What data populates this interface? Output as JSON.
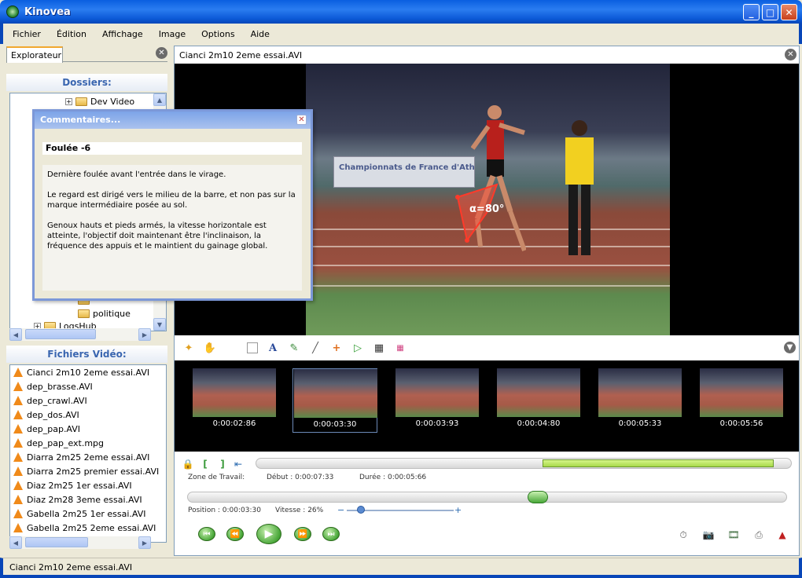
{
  "window": {
    "title": "Kinovea"
  },
  "menu": [
    "Fichier",
    "Édition",
    "Affichage",
    "Image",
    "Options",
    "Aide"
  ],
  "explorer": {
    "tab_label": "Explorateur",
    "folders_heading": "Dossiers:",
    "tree": [
      {
        "label": "Dev Video",
        "expander": "+"
      },
      {
        "label": "",
        "expander": ""
      },
      {
        "label": "politique",
        "expander": ""
      },
      {
        "label": "LogsHub",
        "expander": "+"
      }
    ],
    "videos_heading": "Fichiers Vidéo:",
    "videos": [
      "Cianci 2m10 2eme essai.AVI",
      "dep_brasse.AVI",
      "dep_crawl.AVI",
      "dep_dos.AVI",
      "dep_pap.AVI",
      "dep_pap_ext.mpg",
      "Diarra 2m25 2eme essai.AVI",
      "Diarra 2m25 premier essai.AVI",
      "Diaz 2m25 1er essai.AVI",
      "Diaz 2m28 3eme essai.AVI",
      "Gabella 2m25 1er essai.AVI",
      "Gabella 2m25 2eme essai.AVI"
    ]
  },
  "player": {
    "filename": "Cianci 2m10 2eme essai.AVI",
    "banner_text": "Championnats de France d'Athlétisme",
    "angle_label": "α=80°",
    "thumbnails": [
      "0:00:02:86",
      "0:00:03:30",
      "0:00:03:93",
      "0:00:04:80",
      "0:00:05:33",
      "0:00:05:56"
    ],
    "selected_thumbnail": 1,
    "work_zone_label": "Zone de Travail:",
    "start_label": "Début : 0:00:07:33",
    "duration_label": "Durée : 0:00:05:66",
    "position_label": "Position : 0:00:03:30",
    "speed_label": "Vitesse : 26%"
  },
  "comments": {
    "title": "Commentaires...",
    "header": "Foulée -6",
    "paragraphs": [
      "Dernière foulée avant l'entrée dans le virage.",
      "Le regard est dirigé vers le milieu de la barre, et non pas sur la marque intermédiaire posée au sol.",
      "Genoux hauts et pieds armés, la vitesse horizontale est atteinte, l'objectif doit maintenant être l'inclinaison, la fréquence des appuis et le maintient du gainage global."
    ]
  },
  "status": {
    "text": "Cianci 2m10 2eme essai.AVI"
  },
  "colors": {
    "titlebar": "#0a5fe0",
    "accent_green": "#a8d94a",
    "heading_blue": "#3a66b0"
  }
}
